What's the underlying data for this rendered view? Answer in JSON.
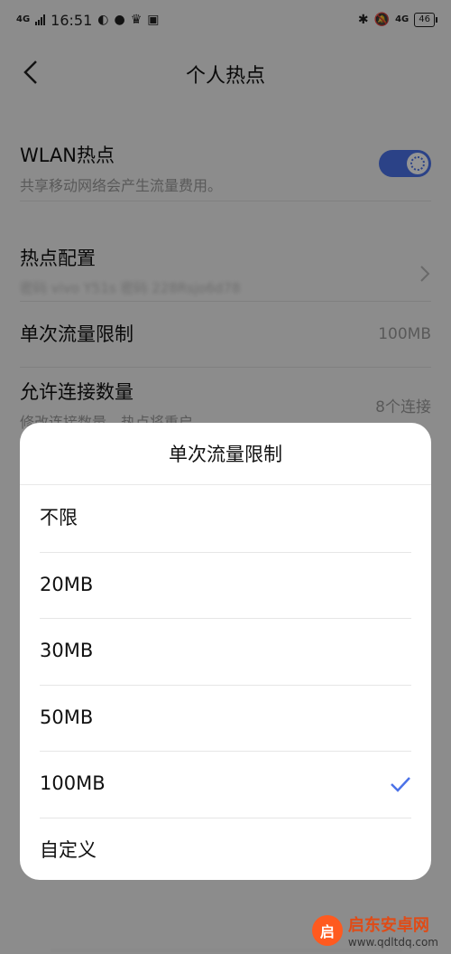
{
  "status_bar": {
    "network": "4G",
    "time": "16:51",
    "right_network": "4G",
    "battery": "46",
    "icons": [
      "moon-icon",
      "chat-icon",
      "crown-icon",
      "mail-icon",
      "bluetooth-icon",
      "mute-bell-icon"
    ]
  },
  "header": {
    "title": "个人热点",
    "back_icon": "chevron-left-icon"
  },
  "settings": {
    "wlan": {
      "title": "WLAN热点",
      "subtitle": "共享移动网络会产生流量费用。",
      "enabled": true
    },
    "config": {
      "title": "热点配置",
      "subtitle": "密码 vivo Y51s 密码 228Rsjo6d78"
    },
    "limit": {
      "title": "单次流量限制",
      "value": "100MB"
    },
    "connections": {
      "title": "允许连接数量",
      "subtitle": "修改连接数量，热点将重启。",
      "value": "8个连接"
    }
  },
  "sheet": {
    "title": "单次流量限制",
    "options": [
      "不限",
      "20MB",
      "30MB",
      "50MB",
      "100MB",
      "自定义"
    ],
    "selected": "100MB",
    "accent": "#4b72e8"
  },
  "watermark": {
    "name": "启东安卓网",
    "url": "www.qdltdq.com"
  }
}
